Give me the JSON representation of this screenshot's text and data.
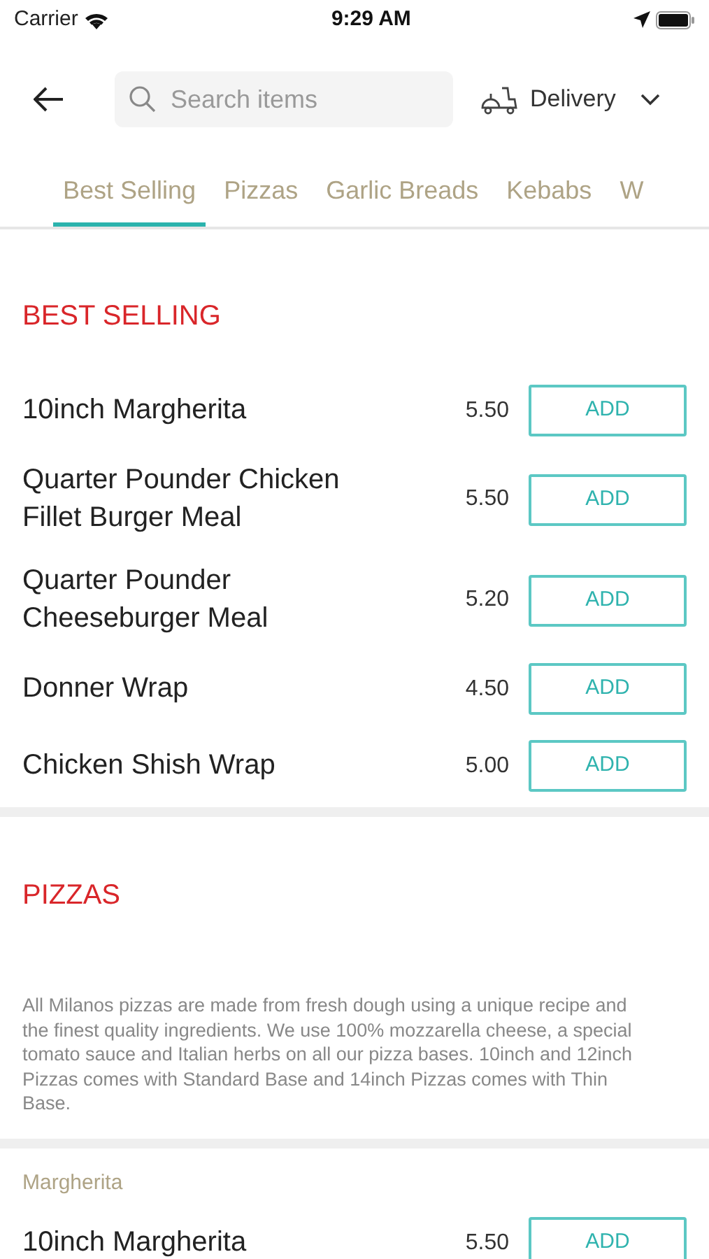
{
  "status_bar": {
    "carrier": "Carrier",
    "time": "9:29 AM"
  },
  "header": {
    "search": {
      "placeholder": "Search items"
    },
    "mode": "Delivery"
  },
  "tabs": [
    {
      "label": "Best Selling",
      "selected": true
    },
    {
      "label": "Pizzas",
      "selected": false
    },
    {
      "label": "Garlic Breads",
      "selected": false
    },
    {
      "label": "Kebabs",
      "selected": false
    },
    {
      "label": "W",
      "selected": false
    }
  ],
  "sections": [
    {
      "title": "BEST SELLING",
      "items": [
        {
          "name": "10inch Margherita",
          "price": "5.50",
          "button": "ADD"
        },
        {
          "name": "Quarter Pounder Chicken Fillet Burger Meal",
          "price": "5.50",
          "button": "ADD"
        },
        {
          "name": "Quarter Pounder Cheeseburger Meal",
          "price": "5.20",
          "button": "ADD"
        },
        {
          "name": "Donner Wrap",
          "price": "4.50",
          "button": "ADD"
        },
        {
          "name": "Chicken Shish Wrap",
          "price": "5.00",
          "button": "ADD"
        }
      ]
    },
    {
      "title": "PIZZAS",
      "description": "All Milanos pizzas are made from fresh dough using a unique recipe and the finest quality ingredients. We use 100% mozzarella cheese, a special tomato sauce and Italian herbs on all our pizza bases. 10inch and 12inch Pizzas comes with Standard Base and 14inch Pizzas comes with Thin Base.",
      "subsection": "Margherita",
      "items": [
        {
          "name": "10inch Margherita",
          "price": "5.50",
          "button": "ADD"
        }
      ]
    }
  ]
}
